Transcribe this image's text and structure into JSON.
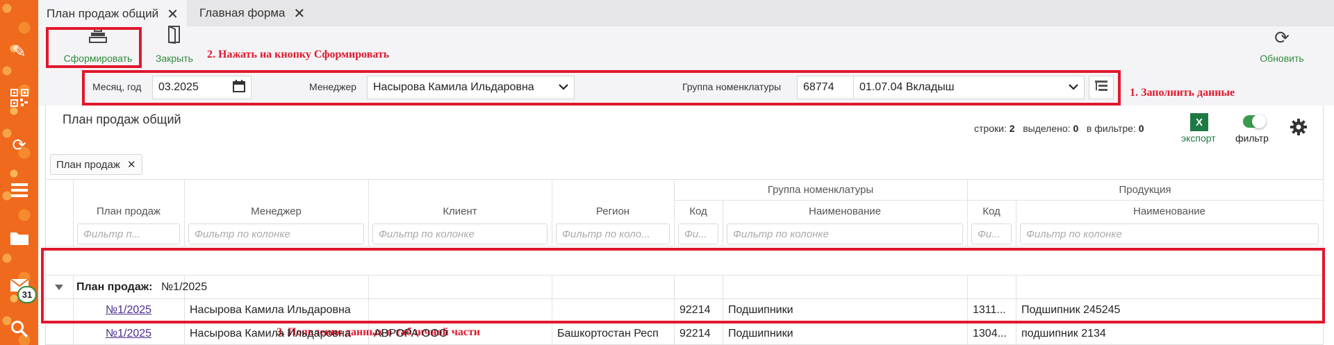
{
  "sidebar": {
    "icons": [
      "pencil-icon",
      "qr-icon",
      "sync-icon",
      "list-icon",
      "folder-icon",
      "mail-icon",
      "search-icon"
    ],
    "mail_badge": "31"
  },
  "tabs": [
    {
      "label": "План продаж общий"
    },
    {
      "label": "Главная форма"
    }
  ],
  "toolbar": {
    "generate_label": "Сформировать",
    "close_label": "Закрыть",
    "refresh_label": "Обновить"
  },
  "annotations": {
    "step1": "1. Заполнить данные",
    "step2": "2. Нажать на кнопку Сформировать",
    "step3": "3. Появление данных в табличной части"
  },
  "filters": {
    "month_label": "Месяц, год",
    "month_value": "03.2025",
    "manager_label": "Менеджер",
    "manager_value": "Насырова Камила Ильдаровна",
    "group_label": "Группа номенклатуры",
    "group_code": "68774",
    "group_value": "01.07.04 Вкладыш"
  },
  "panel": {
    "title": "План продаж общий",
    "rows_label": "строки:",
    "rows_value": "2",
    "selected_label": "выделено:",
    "selected_value": "0",
    "infilter_label": "в фильтре:",
    "infilter_value": "0",
    "export_label": "экспорт",
    "filter_label": "фильтр",
    "chip_label": "План продаж"
  },
  "grid": {
    "group_headers": {
      "nomenclature": "Группа номенклатуры",
      "product": "Продукция"
    },
    "columns": {
      "plan": "План продаж",
      "manager": "Менеджер",
      "client": "Клиент",
      "region": "Регион",
      "g_code": "Код",
      "g_name": "Наименование",
      "p_code": "Код",
      "p_name": "Наименование"
    },
    "filter_placeholders": {
      "plan": "Фильтр п...",
      "manager": "Фильтр по колонке",
      "client": "Фильтр по колонке",
      "region": "Фильтр по коло...",
      "g_code": "Фи...",
      "g_name": "Фильтр по колонке",
      "p_code": "Фи...",
      "p_name": "Фильтр по колонке"
    },
    "group_row": {
      "label": "План продаж:",
      "value": "№1/2025"
    },
    "rows": [
      {
        "plan": "№1/2025",
        "manager": "Насырова Камила Ильдаровна",
        "client": "",
        "region": "",
        "g_code": "92214",
        "g_name": "Подшипники",
        "p_code": "1311...",
        "p_name": "Подшипник 245245"
      },
      {
        "plan": "№1/2025",
        "manager": "Насырова Камила Ильдаровна",
        "client": "АВРОРА ООО",
        "region": "Башкортостан Респ",
        "g_code": "92214",
        "g_name": "Подшипники",
        "p_code": "1304...",
        "p_name": "подшипник 2134"
      }
    ]
  },
  "colors": {
    "accent_green": "#2e8b3a",
    "annotation_red": "#e0182d",
    "sidebar_orange": "#ef6a1c",
    "link_purple": "#4b2d8f"
  }
}
